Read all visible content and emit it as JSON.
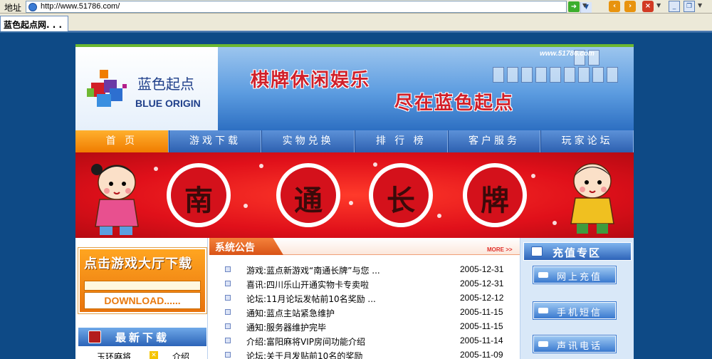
{
  "browser": {
    "address_label": "地址",
    "url": "http://www.51786.com/",
    "tab_title": "蓝色起点网. . ."
  },
  "header": {
    "logo_cn": "蓝色起点",
    "logo_en": "BLUE ORIGIN",
    "site_url": "www.51786.com",
    "slogan_1": "棋牌休闲娱乐",
    "slogan_2": "尽在蓝色起点"
  },
  "nav": {
    "items": [
      {
        "label": "首 页",
        "active": true
      },
      {
        "label": "游戏下载",
        "active": false
      },
      {
        "label": "实物兑换",
        "active": false
      },
      {
        "label": "排 行 榜",
        "active": false
      },
      {
        "label": "客户服务",
        "active": false
      },
      {
        "label": "玩家论坛",
        "active": false
      }
    ]
  },
  "banner": {
    "chars": [
      "南",
      "通",
      "长",
      "牌"
    ]
  },
  "download": {
    "title": "点击游戏大厅下载",
    "button": "DOWNLOAD......"
  },
  "new_downloads": {
    "title": "最新下载",
    "items": [
      {
        "name": "玉环麻将",
        "link": "介绍"
      }
    ]
  },
  "notices": {
    "title": "系统公告",
    "more": "MORE >>",
    "items": [
      {
        "text": "游戏:蓝点新游戏“南通长牌”与您 ...",
        "date": "2005-12-31"
      },
      {
        "text": "喜讯:四川乐山开通实物卡专卖啦",
        "date": "2005-12-31"
      },
      {
        "text": "论坛:11月论坛发帖前10名奖励 ...",
        "date": "2005-12-12"
      },
      {
        "text": "通知:蓝点主站紧急维护",
        "date": "2005-11-15"
      },
      {
        "text": "通知:服务器维护完毕",
        "date": "2005-11-15"
      },
      {
        "text": "介绍:富阳麻将VIP房间功能介绍",
        "date": "2005-11-14"
      },
      {
        "text": "论坛:关于月发贴前10名的奖励",
        "date": "2005-11-09"
      }
    ]
  },
  "recharge": {
    "title": "充值专区",
    "buttons": [
      "网上充值",
      "手机短信",
      "声讯电话"
    ]
  },
  "colors": {
    "page_bg": "#0e4a86",
    "nav_active": "#f07c00",
    "banner_red": "#e0101a",
    "brand_blue": "#2d60b0"
  }
}
